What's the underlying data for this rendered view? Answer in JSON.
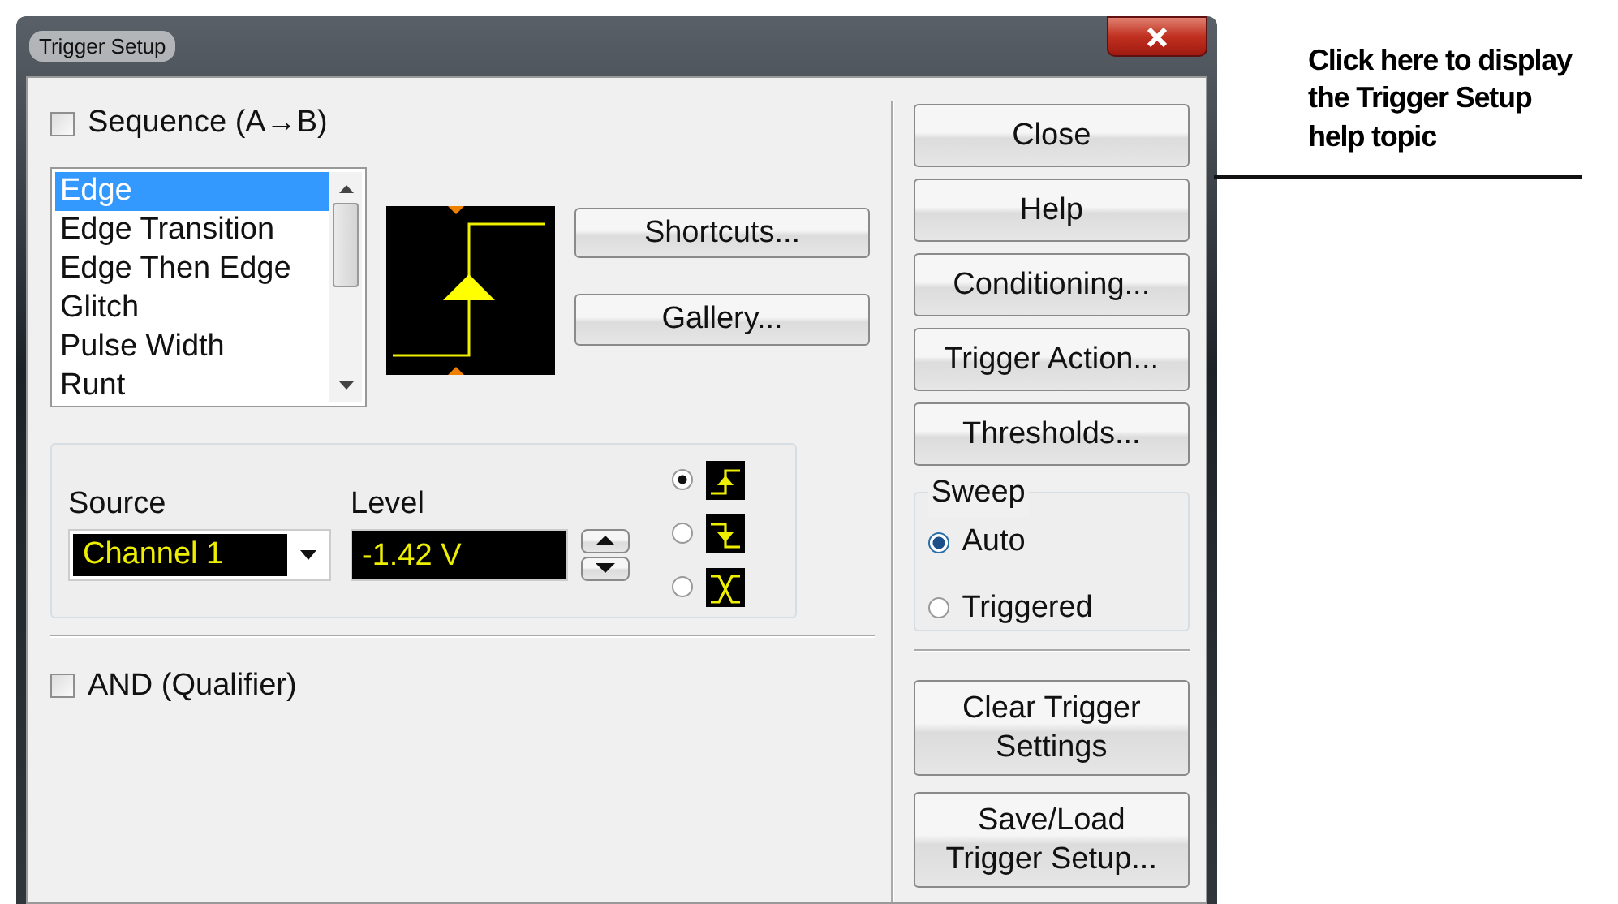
{
  "window": {
    "title": "Trigger Setup"
  },
  "sequence": {
    "label": "Sequence (A→B)",
    "checked": false
  },
  "trigger_types": [
    {
      "label": "Edge",
      "selected": true
    },
    {
      "label": "Edge Transition",
      "selected": false
    },
    {
      "label": "Edge Then Edge",
      "selected": false
    },
    {
      "label": "Glitch",
      "selected": false
    },
    {
      "label": "Pulse Width",
      "selected": false
    },
    {
      "label": "Runt",
      "selected": false
    }
  ],
  "side_actions": [
    "Shortcuts...",
    "Gallery..."
  ],
  "source": {
    "label": "Source",
    "value": "Channel 1"
  },
  "level": {
    "label": "Level",
    "value": "-1.42 V"
  },
  "slopes": [
    {
      "kind": "rising",
      "selected": true
    },
    {
      "kind": "falling",
      "selected": false
    },
    {
      "kind": "either",
      "selected": false
    }
  ],
  "qualifier": {
    "label": "AND (Qualifier)",
    "checked": false
  },
  "buttons": [
    "Close",
    "Help",
    "Conditioning...",
    "Trigger Action...",
    "Thresholds..."
  ],
  "sweep": {
    "title": "Sweep",
    "options": [
      {
        "label": "Auto",
        "selected": true
      },
      {
        "label": "Triggered",
        "selected": false
      }
    ]
  },
  "bottom_buttons": [
    "Clear Trigger\nSettings",
    "Save/Load\nTrigger Setup..."
  ],
  "callout": "Click here to display\nthe Trigger Setup\nhelp topic"
}
